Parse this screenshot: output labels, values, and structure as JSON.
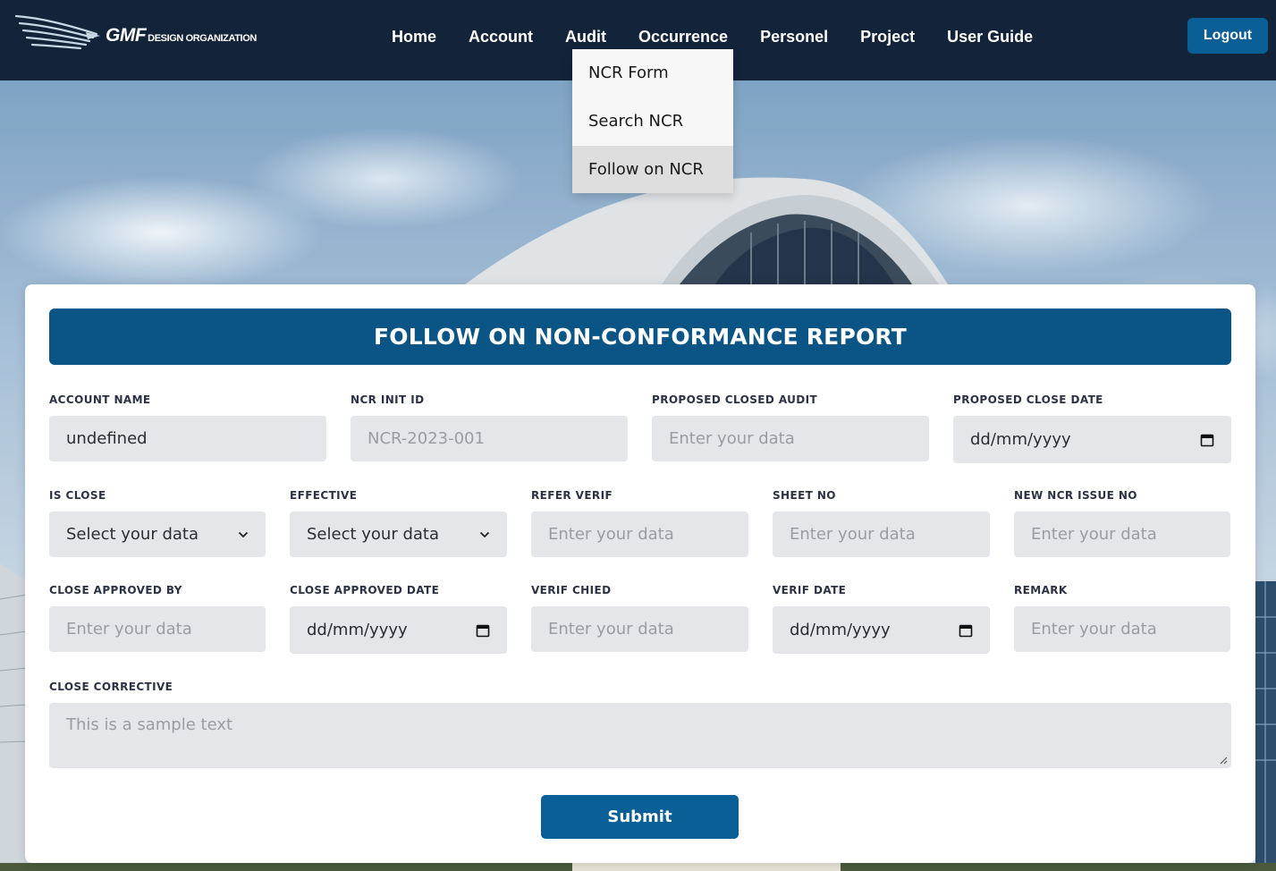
{
  "brand": {
    "name": "GMF",
    "subtitle": "DESIGN ORGANIZATION"
  },
  "nav": {
    "items": [
      "Home",
      "Account",
      "Audit",
      "Occurrence",
      "Personel",
      "Project",
      "User Guide"
    ],
    "logout_label": "Logout"
  },
  "audit_dropdown": {
    "items": [
      "NCR Form",
      "Search NCR",
      "Follow on NCR"
    ],
    "active_item": "Follow on NCR"
  },
  "form": {
    "title": "FOLLOW ON NON-CONFORMANCE REPORT",
    "account_name": {
      "label": "ACCOUNT NAME",
      "value": "undefined"
    },
    "ncr_init_id": {
      "label": "NCR INIT ID",
      "value": "NCR-2023-001"
    },
    "proposed_closed_audit": {
      "label": "PROPOSED CLOSED AUDIT",
      "placeholder": "Enter your data"
    },
    "proposed_close_date": {
      "label": "PROPOSED CLOSE DATE",
      "placeholder": "dd/mm/yyyy"
    },
    "is_close": {
      "label": "IS CLOSE",
      "selected": "Select your data"
    },
    "effective": {
      "label": "EFFECTIVE",
      "selected": "Select your data"
    },
    "refer_verif": {
      "label": "REFER VERIF",
      "placeholder": "Enter your data"
    },
    "sheet_no": {
      "label": "SHEET NO",
      "placeholder": "Enter your data"
    },
    "new_ncr_issue_no": {
      "label": "NEW NCR ISSUE NO",
      "placeholder": "Enter your data"
    },
    "close_approved_by": {
      "label": "CLOSE APPROVED BY",
      "placeholder": "Enter your data"
    },
    "close_approved_date": {
      "label": "CLOSE APPROVED DATE",
      "placeholder": "dd/mm/yyyy"
    },
    "verif_chied": {
      "label": "VERIF CHIED",
      "placeholder": "Enter your data"
    },
    "verif_date": {
      "label": "VERIF DATE",
      "placeholder": "dd/mm/yyyy"
    },
    "remark": {
      "label": "REMARK",
      "placeholder": "Enter your data"
    },
    "close_corrective": {
      "label": "CLOSE CORRECTIVE",
      "placeholder": "This is a sample text"
    },
    "submit_label": "Submit"
  },
  "colors": {
    "navbar": "#13233a",
    "primary": "#0b5f97",
    "header": "#0b5486",
    "input_bg": "#e5e6ea"
  }
}
